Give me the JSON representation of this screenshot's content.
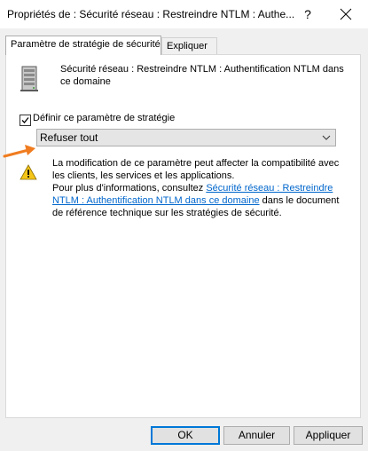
{
  "window": {
    "title": "Propriétés de : Sécurité réseau : Restreindre NTLM : Authe...",
    "help_glyph": "?",
    "close_icon": "close-icon"
  },
  "tabs": [
    {
      "label": "Paramètre de stratégie de sécurité",
      "selected": true
    },
    {
      "label": "Expliquer",
      "selected": false
    }
  ],
  "policy": {
    "heading": "Sécurité réseau : Restreindre NTLM : Authentification NTLM dans ce domaine",
    "define_label": "Définir ce paramètre de stratégie",
    "define_checked": true,
    "dropdown_value": "Refuser tout"
  },
  "warning": {
    "text1": "La modification de ce paramètre peut affecter la compatibilité avec les clients, les services et les applications.",
    "text2_prefix": "Pour plus d'informations, consultez ",
    "link_text": "Sécurité réseau : Restreindre NTLM : Authentification NTLM dans ce domaine",
    "text2_suffix": " dans le document de référence technique sur les stratégies de sécurité."
  },
  "buttons": {
    "ok": "OK",
    "cancel": "Annuler",
    "apply": "Appliquer"
  },
  "colors": {
    "accent": "#0078d7",
    "link": "#0066cc",
    "arrow": "#f07c1f",
    "warning": "#f5c518"
  }
}
